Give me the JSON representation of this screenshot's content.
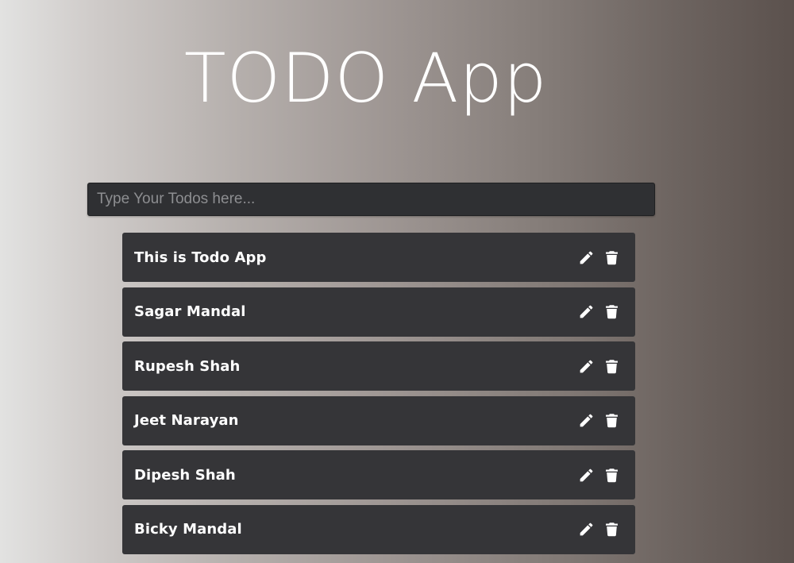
{
  "header": {
    "title": "TODO App"
  },
  "input": {
    "placeholder": "Type Your Todos here...",
    "value": ""
  },
  "todos": [
    {
      "text": "This is Todo App",
      "edit_icon": "pencil-icon",
      "delete_icon": "trash-icon"
    },
    {
      "text": "Sagar Mandal",
      "edit_icon": "pencil-icon",
      "delete_icon": "trash-icon"
    },
    {
      "text": "Rupesh Shah",
      "edit_icon": "pencil-icon",
      "delete_icon": "trash-icon"
    },
    {
      "text": "Jeet Narayan",
      "edit_icon": "pencil-icon",
      "delete_icon": "trash-icon"
    },
    {
      "text": "Dipesh Shah",
      "edit_icon": "pencil-icon",
      "delete_icon": "trash-icon"
    },
    {
      "text": "Bicky Mandal",
      "edit_icon": "pencil-icon",
      "delete_icon": "trash-icon"
    }
  ],
  "colors": {
    "item_background": "#353538",
    "input_background": "#2f3033",
    "text": "#ffffff"
  }
}
